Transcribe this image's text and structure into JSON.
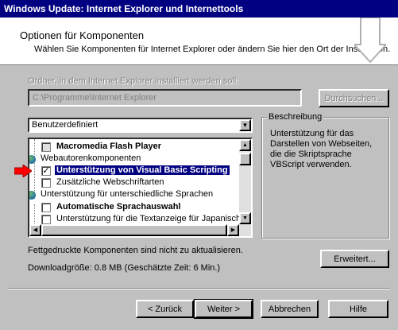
{
  "window": {
    "title": "Windows Update: Internet Explorer und Internettools"
  },
  "header": {
    "title": "Optionen für Komponenten",
    "subtitle": "Wählen Sie Komponenten für Internet Explorer oder ändern Sie hier den Ort der Installation."
  },
  "folder": {
    "label": "Ordner, in dem Internet Explorer installiert werden soll:",
    "value": "C:\\Programme\\Internet Explorer",
    "browse_label": "Durchsuchen..."
  },
  "setup_type": {
    "selected": "Benutzerdefiniert"
  },
  "components": [
    {
      "text": "Macromedia Flash Player",
      "kind": "checkbox",
      "bold": true,
      "checked": false,
      "gray": true
    },
    {
      "text": "Webautorenkomponenten",
      "kind": "group"
    },
    {
      "text": "Unterstützung von Visual Basic Scripting",
      "kind": "checkbox",
      "bold": true,
      "checked": true,
      "selected": true
    },
    {
      "text": "Zusätzliche Webschriftarten",
      "kind": "checkbox",
      "checked": false
    },
    {
      "text": "Unterstützung für unterschiedliche Sprachen",
      "kind": "group"
    },
    {
      "text": "Automatische Sprachauswahl",
      "kind": "checkbox",
      "bold": true,
      "checked": false
    },
    {
      "text": "Unterstützung für die Textanzeige für Japanisch",
      "kind": "checkbox",
      "checked": false
    }
  ],
  "description": {
    "legend": "Beschreibung",
    "text": "Unterstützung für das Darstellen von Webseiten, die die Skriptsprache VBScript verwenden."
  },
  "notes": {
    "bold_info": "Fettgedruckte Komponenten sind nicht zu aktualisieren.",
    "download_size": "Downloadgröße: 0.8 MB (Geschätzte Zeit: 6 Min.)"
  },
  "buttons": {
    "advanced": "Erweitert...",
    "back": "< Zurück",
    "next": "Weiter >",
    "cancel": "Abbrechen",
    "help": "Hilfe"
  },
  "colors": {
    "titlebar": "#000080",
    "selection": "#000080",
    "face": "#c0c0c0",
    "pointer_arrow": "#ff0000"
  }
}
